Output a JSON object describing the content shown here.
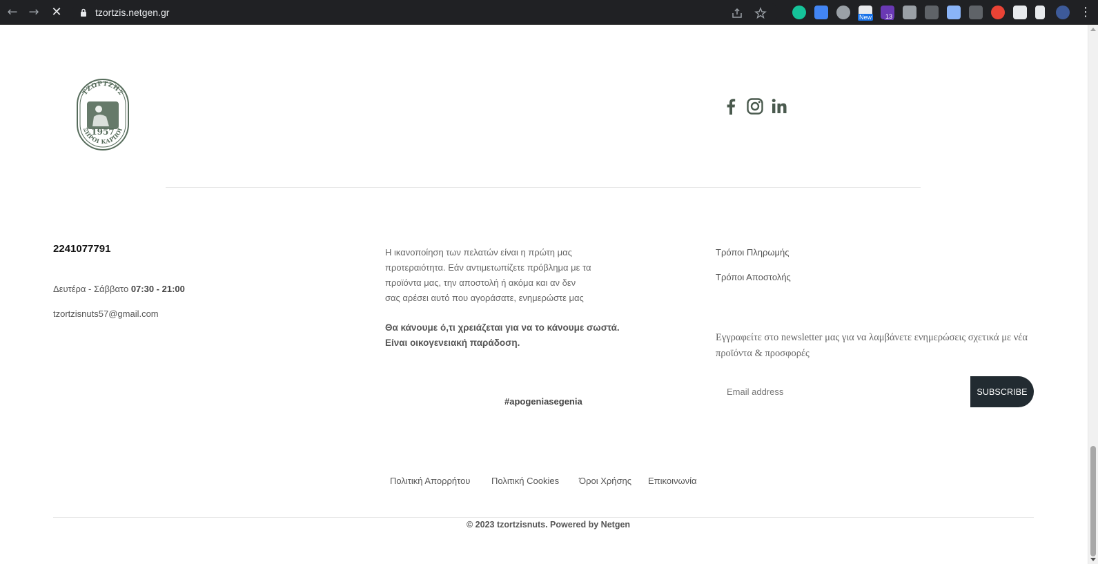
{
  "browser": {
    "url": "tzortzis.netgen.gr",
    "extension_badges": {
      "new": "New",
      "count": "13"
    }
  },
  "brand": {
    "logo_text_top": "ΤΖΩΡΤΖΗΣ",
    "logo_year": "1957",
    "logo_text_bottom": "ΞΗΡΟΙ ΚΑΡΠΟΙ",
    "accent_color": "#556b5a"
  },
  "social": [
    "facebook-icon",
    "instagram-icon",
    "linkedin-icon"
  ],
  "contact": {
    "phone": "2241077791",
    "hours_label": "Δευτέρα - Σάββατο",
    "hours_time": "07:30 - 21:00",
    "email": "tzortzisnuts57@gmail.com"
  },
  "about": {
    "text": "Η ικανοποίηση των πελατών είναι η πρώτη μας προτεραιότητα. Εάν αντιμετωπίζετε πρόβλημα με τα προϊόντα μας, την αποστολή ή ακόμα και αν δεν σας αρέσει αυτό που αγοράσατε, ενημερώστε μας",
    "motto": "Θα κάνουμε ό,τι χρειάζεται για να το κάνουμε σωστά. Είναι οικογενειακή παράδοση.",
    "hashtag": "#apogeniasegenia"
  },
  "info_links": {
    "payment": "Τρόποι Πληρωμής",
    "shipping": "Τρόποι Αποστολής"
  },
  "newsletter": {
    "text": "Εγγραφείτε στο newsletter μας για να λαμβάνετε ενημερώσεις σχετικά με νέα προϊόντα & προσφορές",
    "placeholder": "Email address",
    "button": "SUBSCRIBE"
  },
  "footer": {
    "privacy": "Πολιτική Απορρήτου",
    "cookies": "Πολιτική Cookies",
    "terms": "Όροι Χρήσης",
    "contact": "Επικοινωνία",
    "copyright": "© 2023 tzortzisnuts. Powered by Netgen"
  }
}
